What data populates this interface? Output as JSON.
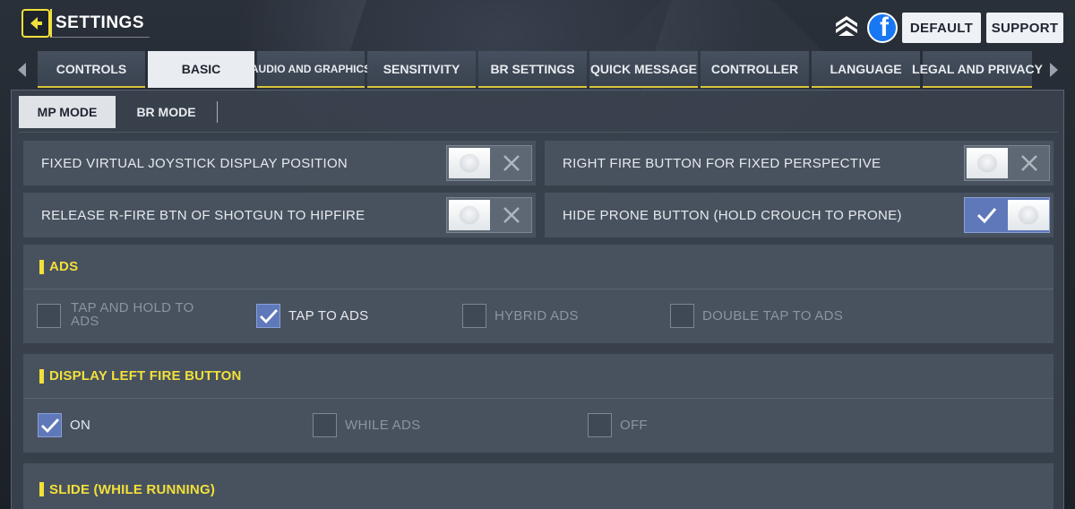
{
  "header": {
    "title": "SETTINGS",
    "default_label": "DEFAULT",
    "support_label": "SUPPORT",
    "icons": [
      "back-arrow-icon",
      "rank-chevron-icon",
      "facebook-icon"
    ],
    "facebook_letter": "f"
  },
  "tabs": [
    {
      "label": "CONTROLS",
      "active": false
    },
    {
      "label": "BASIC",
      "active": true
    },
    {
      "label": "AUDIO AND GRAPHICS",
      "active": false
    },
    {
      "label": "SENSITIVITY",
      "active": false
    },
    {
      "label": "BR SETTINGS",
      "active": false
    },
    {
      "label": "QUICK MESSAGE",
      "active": false
    },
    {
      "label": "CONTROLLER",
      "active": false
    },
    {
      "label": "LANGUAGE",
      "active": false
    },
    {
      "label": "LEGAL AND PRIVACY",
      "active": false
    }
  ],
  "modes": [
    {
      "label": "MP MODE",
      "active": true
    },
    {
      "label": "BR MODE",
      "active": false
    }
  ],
  "toggles": [
    {
      "label": "FIXED VIRTUAL JOYSTICK DISPLAY POSITION",
      "on": false
    },
    {
      "label": "RIGHT FIRE BUTTON FOR FIXED PERSPECTIVE",
      "on": false
    },
    {
      "label": "RELEASE R-FIRE BTN OF SHOTGUN TO HIPFIRE",
      "on": false
    },
    {
      "label": "HIDE PRONE BUTTON (HOLD CROUCH TO PRONE)",
      "on": true
    }
  ],
  "ads": {
    "title": "ADS",
    "options": [
      {
        "label_line1": "TAP AND HOLD TO",
        "label_line2": "ADS",
        "checked": false
      },
      {
        "label": "TAP TO ADS",
        "checked": true
      },
      {
        "label": "HYBRID ADS",
        "checked": false
      },
      {
        "label": "DOUBLE TAP TO ADS",
        "checked": false
      }
    ]
  },
  "left_fire": {
    "title": "DISPLAY LEFT FIRE BUTTON",
    "options": [
      {
        "label": "ON",
        "checked": true
      },
      {
        "label": "WHILE ADS",
        "checked": false
      },
      {
        "label": "OFF",
        "checked": false
      }
    ]
  },
  "slide": {
    "title": "SLIDE (WHILE RUNNING)"
  },
  "colors": {
    "accent_yellow": "#f2e03a",
    "checked_blue": "#5f78b9",
    "panel": "#48525f"
  }
}
